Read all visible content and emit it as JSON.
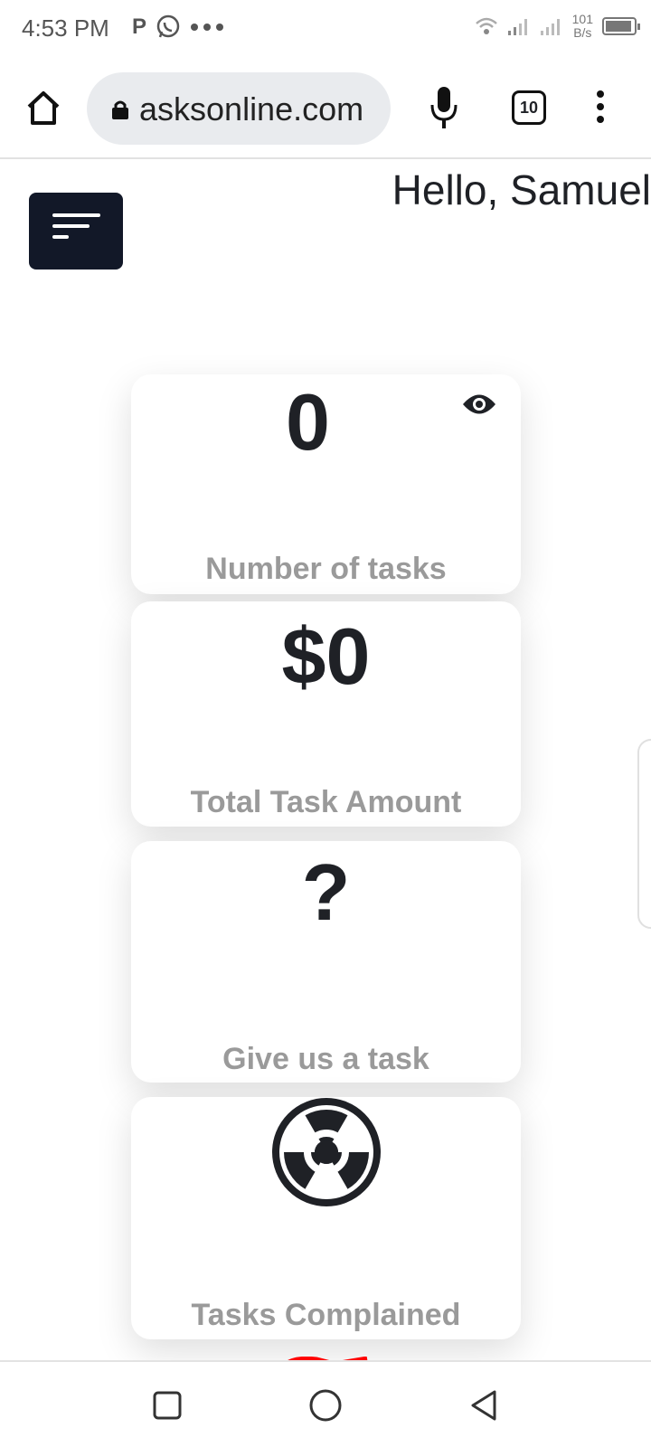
{
  "status_bar": {
    "time": "4:53 PM",
    "app_icons": [
      "p-icon",
      "whatsapp-icon",
      "more-dots-icon"
    ],
    "net_speed_value": "101",
    "net_speed_unit": "B/s"
  },
  "browser": {
    "url": "asksonline.com",
    "tab_count": "10"
  },
  "page": {
    "greeting": "Hello, Samuel",
    "cards": [
      {
        "value": "0",
        "label": "Number of tasks"
      },
      {
        "value": "$0",
        "label": "Total Task Amount"
      },
      {
        "value": "?",
        "label": "Give us a task"
      },
      {
        "icon": "radiation-icon",
        "label": "Tasks Complained"
      }
    ]
  },
  "colors": {
    "menu_button_bg": "#121828",
    "card_value": "#1f2126",
    "card_label": "#9a9a9a",
    "peek_accent": "#ff0000"
  }
}
